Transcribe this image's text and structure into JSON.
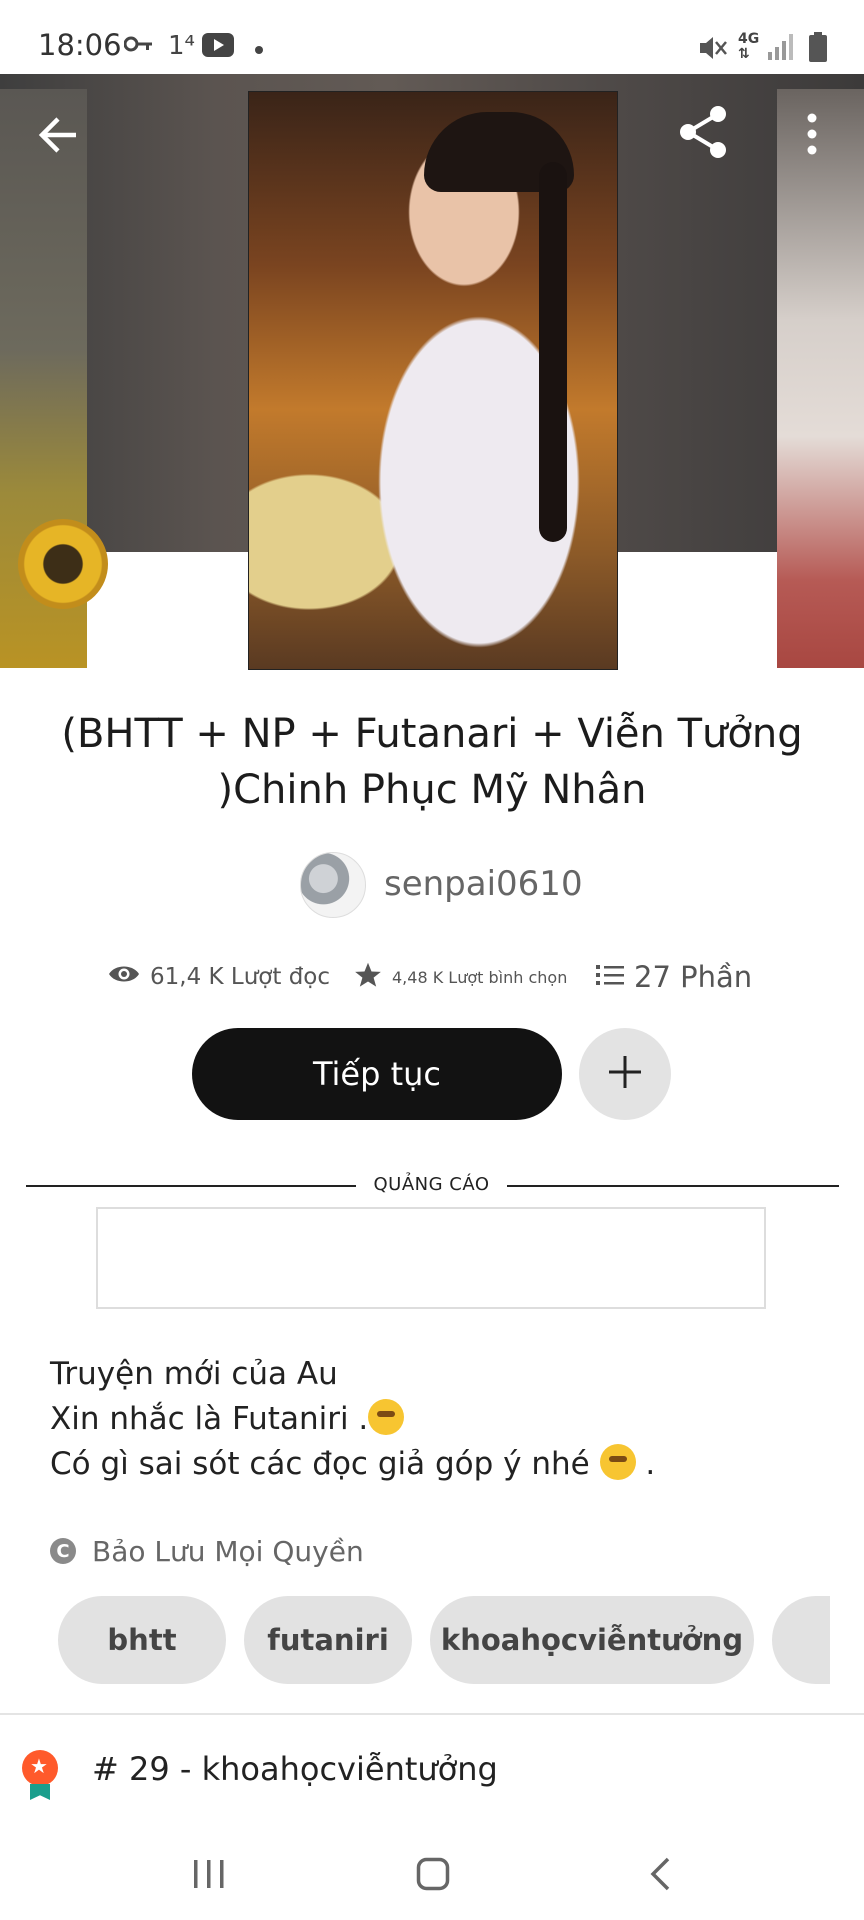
{
  "status_bar": {
    "time": "18:06",
    "icons": [
      "key-icon",
      "one-notification-icon",
      "youtube-icon",
      "dot-icon",
      "mute-icon",
      "4g-icon",
      "signal-icon",
      "battery-icon"
    ],
    "network": "4G"
  },
  "story": {
    "title": "(BHTT + NP + Futanari + Viễn Tưởng  )Chinh Phục Mỹ Nhân",
    "author": "senpai0610",
    "stats": {
      "reads": "61,4 K Lượt đọc",
      "votes": "4,48 K Lượt bình chọn",
      "parts": "27 Phần"
    },
    "continue_label": "Tiếp tục",
    "ad_label": "QUẢNG CÁO",
    "description": [
      "Truyện mới của Au",
      "Xin nhắc là Futaniri .",
      "Có gì sai sót các đọc giả góp ý nhé",
      " ."
    ],
    "copyright": "Bảo Lưu Mọi Quyền",
    "tags": [
      "bhtt",
      "futaniri",
      "khoahọcviễntưởng"
    ],
    "ranking": "# 29 - khoahọcviễntưởng"
  }
}
